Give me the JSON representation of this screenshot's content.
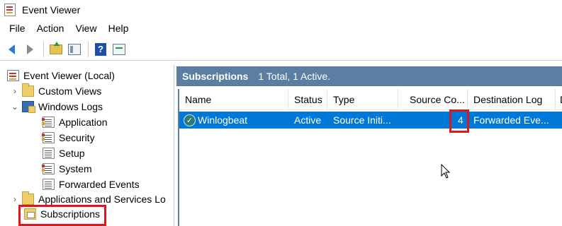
{
  "window": {
    "title": "Event Viewer"
  },
  "menu": [
    "File",
    "Action",
    "View",
    "Help"
  ],
  "toolbar": {
    "icons": [
      "back-arrow-icon",
      "forward-arrow-icon",
      "folder-up-icon",
      "show-hide-tree-icon",
      "help-icon",
      "action-pane-icon"
    ],
    "help_glyph": "?"
  },
  "tree": {
    "root": "Event Viewer (Local)",
    "custom_views": "Custom Views",
    "windows_logs": "Windows Logs",
    "logs": [
      "Application",
      "Security",
      "Setup",
      "System",
      "Forwarded Events"
    ],
    "app_services": "Applications and Services Lo",
    "subscriptions": "Subscriptions"
  },
  "content": {
    "title": "Subscriptions",
    "summary": "1 Total, 1 Active."
  },
  "table": {
    "columns": [
      "Name",
      "Status",
      "Type",
      "Source Co...",
      "Destination Log",
      "D"
    ],
    "rows": [
      {
        "name": "Winlogbeat",
        "status": "Active",
        "type": "Source Initi...",
        "source_count": "4",
        "destination_log": "Forwarded Eve..."
      }
    ]
  },
  "colors": {
    "accent": "#0078d7",
    "header": "#5b7fa3",
    "highlight": "#e0151f"
  }
}
